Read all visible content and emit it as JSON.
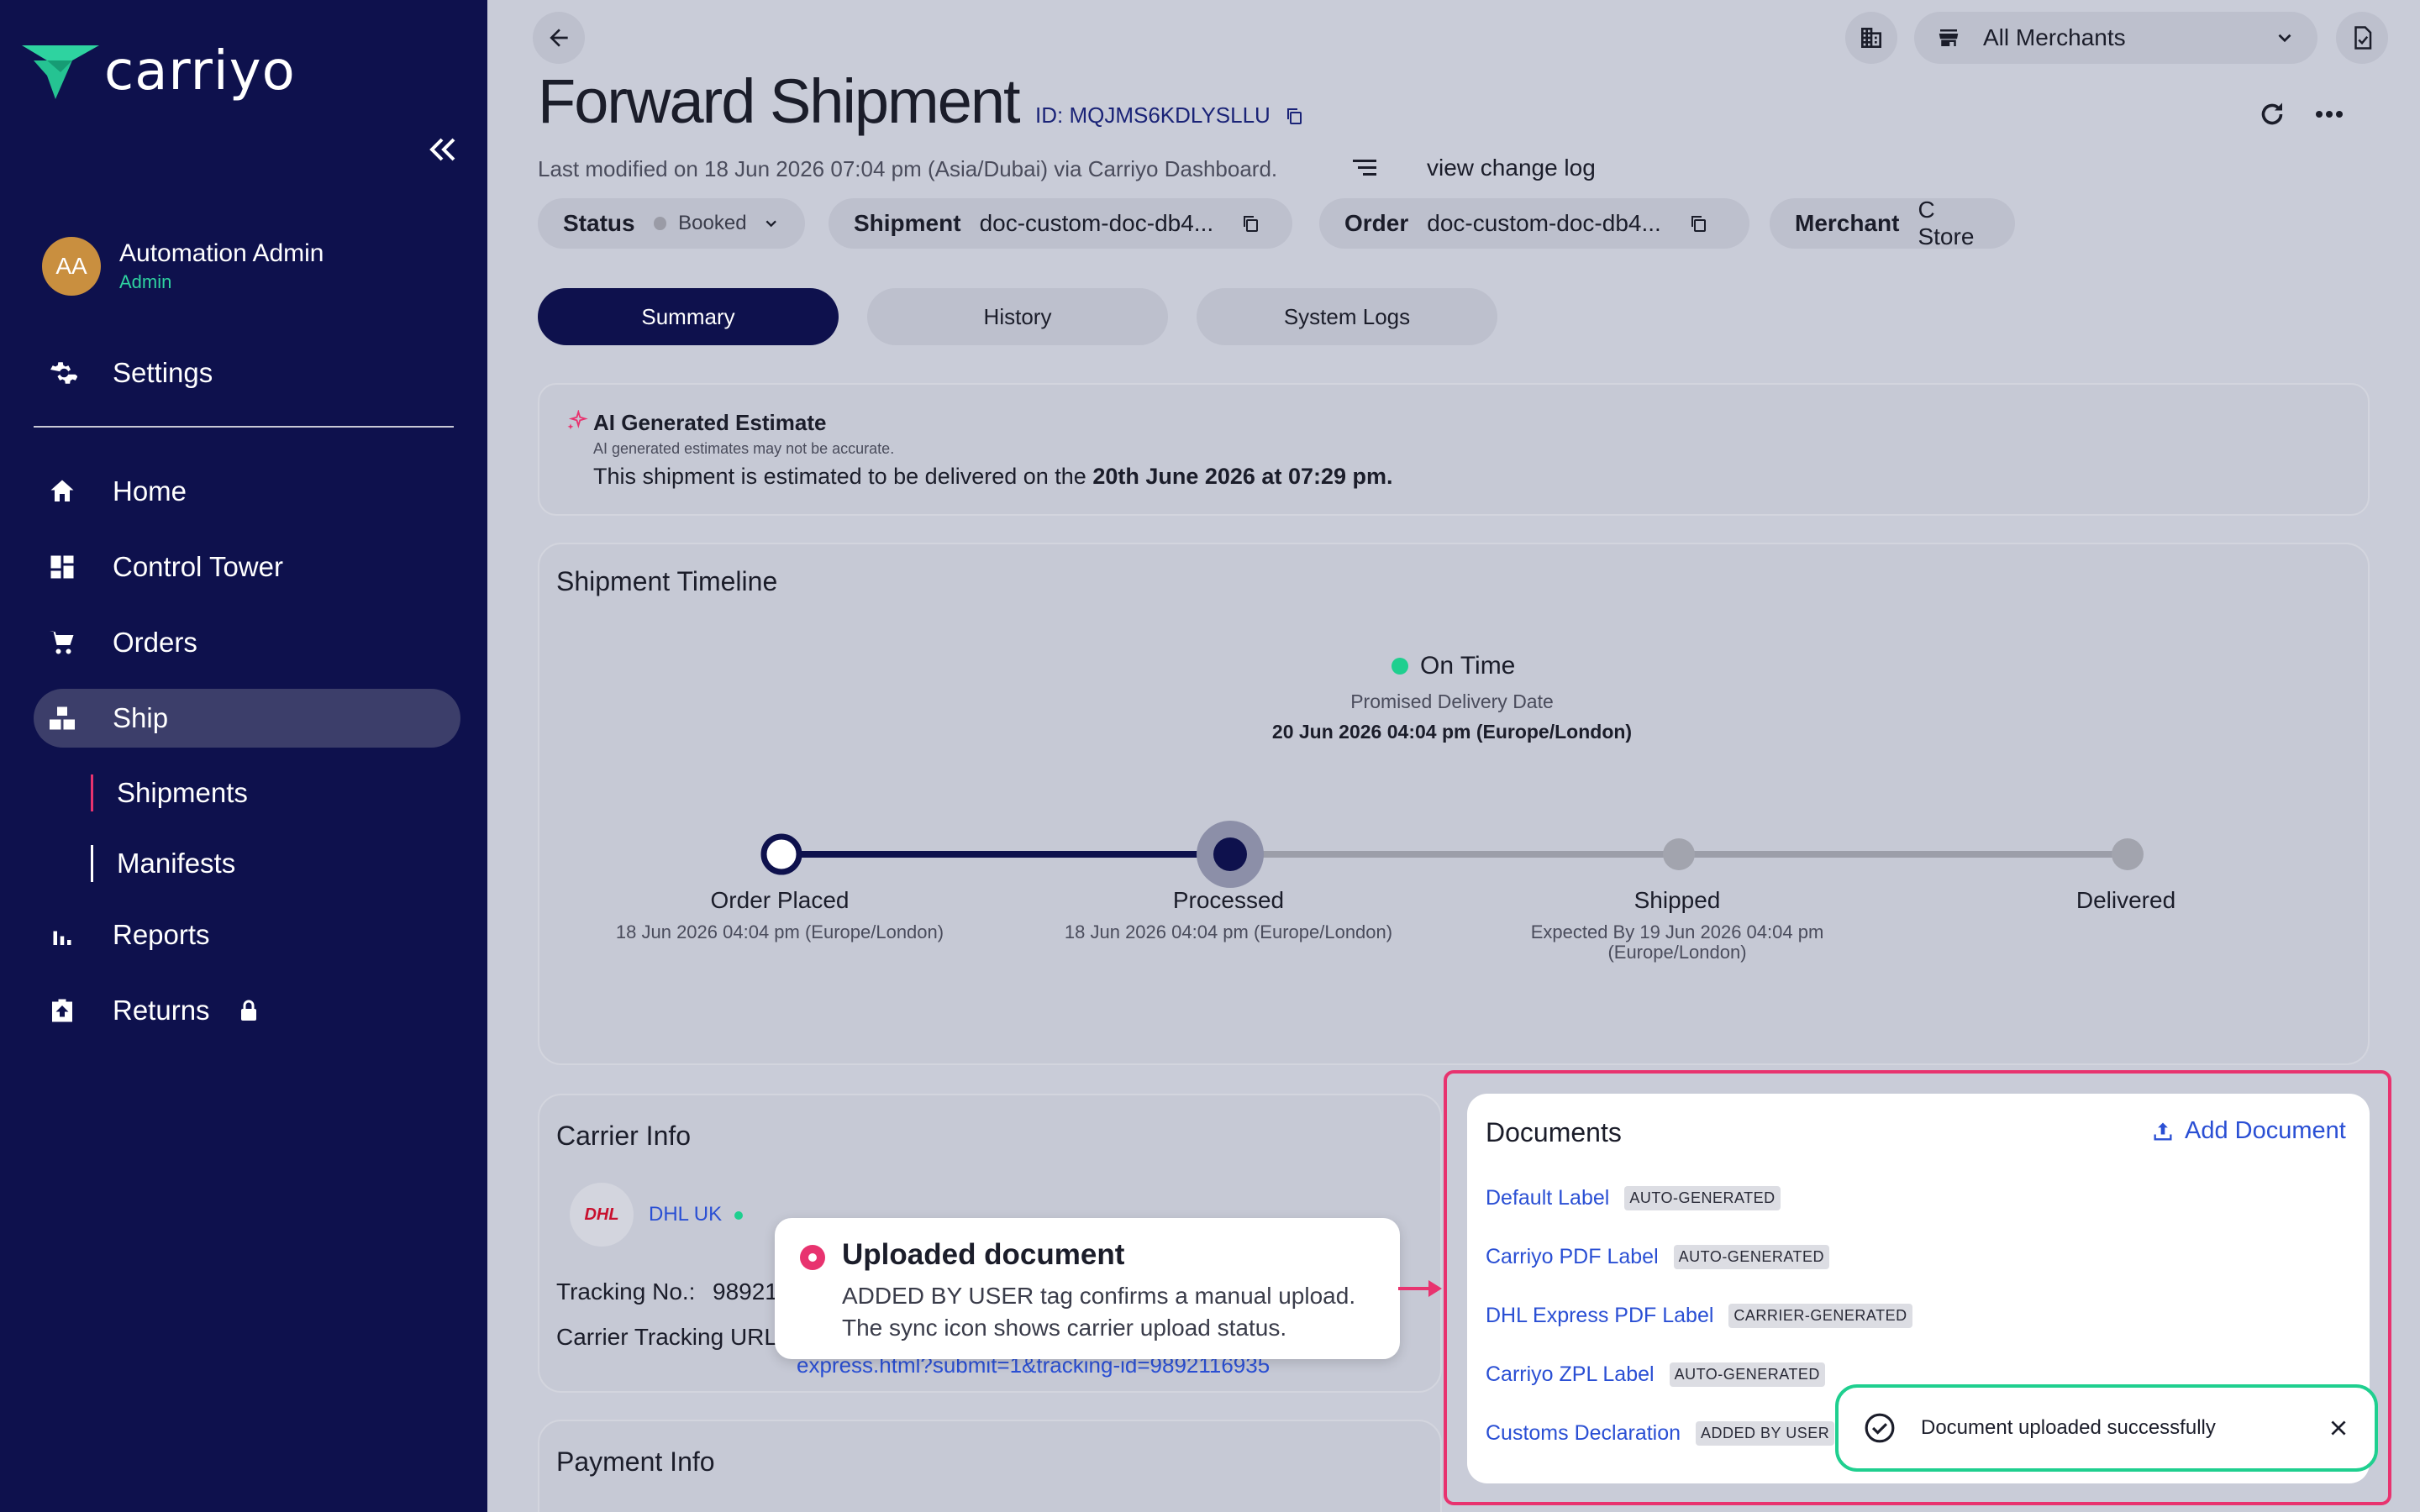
{
  "sidebar": {
    "brand": "carriyo",
    "user": {
      "initials": "AA",
      "name": "Automation Admin",
      "role": "Admin"
    },
    "settings_label": "Settings",
    "items": [
      {
        "label": "Home",
        "icon": "home-icon"
      },
      {
        "label": "Control Tower",
        "icon": "dashboard-icon"
      },
      {
        "label": "Orders",
        "icon": "cart-icon"
      },
      {
        "label": "Ship",
        "icon": "boxes-icon"
      },
      {
        "label": "Reports",
        "icon": "bar-chart-icon"
      },
      {
        "label": "Returns",
        "icon": "return-box-icon"
      }
    ],
    "sub_items": [
      {
        "label": "Shipments"
      },
      {
        "label": "Manifests"
      }
    ]
  },
  "header": {
    "merchant_select": "All Merchants",
    "title": "Forward Shipment",
    "id_text": "ID: MQJMS6KDLYSLLU",
    "last_modified": "Last modified on 18 Jun 2026 07:04 pm (Asia/Dubai) via Carriyo Dashboard.",
    "change_log": "view change log"
  },
  "pills": {
    "status_key": "Status",
    "status_val": "Booked",
    "shipment_key": "Shipment",
    "shipment_val": "doc-custom-doc-db4...",
    "order_key": "Order",
    "order_val": "doc-custom-doc-db4...",
    "merchant_key": "Merchant",
    "merchant_val": "C Store"
  },
  "tabs": [
    {
      "label": "Summary"
    },
    {
      "label": "History"
    },
    {
      "label": "System Logs"
    }
  ],
  "ai_estimate": {
    "title": "AI Generated Estimate",
    "disclaimer": "AI generated estimates may not be accurate.",
    "text_prefix": "This shipment is estimated to be delivered on the ",
    "text_bold": "20th June 2026 at 07:29 pm."
  },
  "timeline": {
    "title": "Shipment Timeline",
    "status": "On Time",
    "promised_label": "Promised Delivery Date",
    "promised_date": "20 Jun 2026 04:04 pm (Europe/London)",
    "milestones": [
      {
        "label": "Order Placed",
        "sub": "18 Jun 2026 04:04 pm (Europe/London)"
      },
      {
        "label": "Processed",
        "sub": "18 Jun 2026 04:04 pm (Europe/London)"
      },
      {
        "label": "Shipped",
        "sub": "Expected By 19 Jun 2026 04:04 pm (Europe/London)"
      },
      {
        "label": "Delivered",
        "sub": ""
      }
    ]
  },
  "carrier": {
    "title": "Carrier Info",
    "logo_text": "DHL",
    "name": "DHL UK",
    "tracking_label": "Tracking No.:",
    "tracking_val": "98921",
    "url_label": "Carrier Tracking URL:",
    "url_val": "express.html?submit=1&tracking-id=9892116935"
  },
  "payment": {
    "title": "Payment Info"
  },
  "tooltip": {
    "title": "Uploaded document",
    "body": "ADDED BY USER tag confirms a manual upload. The sync icon shows carrier upload status."
  },
  "documents": {
    "title": "Documents",
    "add_label": "Add Document",
    "rows": [
      {
        "name": "Default Label",
        "tag": "AUTO-GENERATED"
      },
      {
        "name": "Carriyo PDF Label",
        "tag": "AUTO-GENERATED"
      },
      {
        "name": "DHL Express PDF Label",
        "tag": "CARRIER-GENERATED"
      },
      {
        "name": "Carriyo ZPL Label",
        "tag": "AUTO-GENERATED"
      },
      {
        "name": "Customs Declaration",
        "tag": "ADDED BY USER"
      }
    ]
  },
  "toast": {
    "message": "Document uploaded successfully"
  },
  "colors": {
    "sidebar_bg": "#0e114d",
    "accent": "#0e114d",
    "highlight": "#e8336f",
    "success": "#1fcf8f",
    "link": "#2a4fd4"
  }
}
